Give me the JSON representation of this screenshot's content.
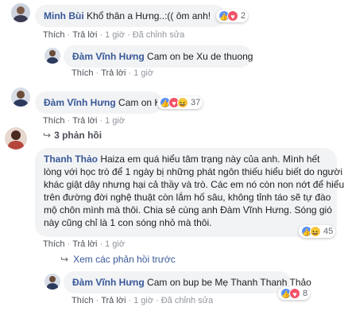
{
  "comments": [
    {
      "name": "Minh Bùi",
      "text": "Khổ thân a Hưng..:(( ôm anh!",
      "reaction_count": "2",
      "actions": {
        "like": "Thích",
        "reply": "Trả lời",
        "time": "1 giờ",
        "edited": "Đã chỉnh sửa"
      }
    },
    {
      "name": "Đàm Vĩnh Hưng",
      "text": "Cam on be Xu de thuong",
      "actions": {
        "like": "Thích",
        "reply": "Trả lời",
        "time": "1 giờ"
      }
    },
    {
      "name": "Đàm Vĩnh Hưng",
      "text": "Cam on K",
      "reaction_count": "37",
      "actions": {
        "like": "Thích",
        "reply": "Trả lời",
        "time": "1 giờ"
      },
      "replies_label": "3 phản hồi"
    },
    {
      "name": "Thanh Thảo",
      "lines": [
        "Haiza em quá hiểu tâm trạng này của anh. Mình hết",
        "lòng với học trò để 1 ngày bị những phát ngôn thiếu hiểu biết do người",
        "khác giật dây nhưng hại cả thầy và trò. Các em nó còn non nớt để hiểu",
        "trên đường đời nghệ thuật còn lắm hố sâu, không tỉnh táo sẽ tự đào",
        "mộ chôn mình mà thôi. Chia sẻ cùng anh Đàm Vĩnh Hưng. Sóng gió",
        "này cũng chỉ là 1 con sóng nhỏ mà thôi."
      ],
      "reaction_count": "45",
      "actions": {
        "like": "Thích",
        "reply": "Trả lời",
        "time": "1 giờ"
      },
      "more_replies": "Xem các phản hồi trước"
    },
    {
      "name": "Đàm Vĩnh Hưng",
      "text": "Cam on bup be Mẹ Thanh Thanh Thảo",
      "reaction_count": "8",
      "actions": {
        "like": "Thích",
        "reply": "Trả lời",
        "time": "1 giờ",
        "edited": "Đã chỉnh sửa"
      }
    }
  ],
  "colors": {
    "name": "#385898",
    "bubble": "#f2f3f5",
    "meta": "#90949c",
    "like": "#5890ff",
    "love": "#f25268",
    "haha": "#f7c94a"
  },
  "icons": [
    "like-icon",
    "love-icon",
    "haha-icon",
    "verified-icon",
    "reply-arrow-icon"
  ]
}
